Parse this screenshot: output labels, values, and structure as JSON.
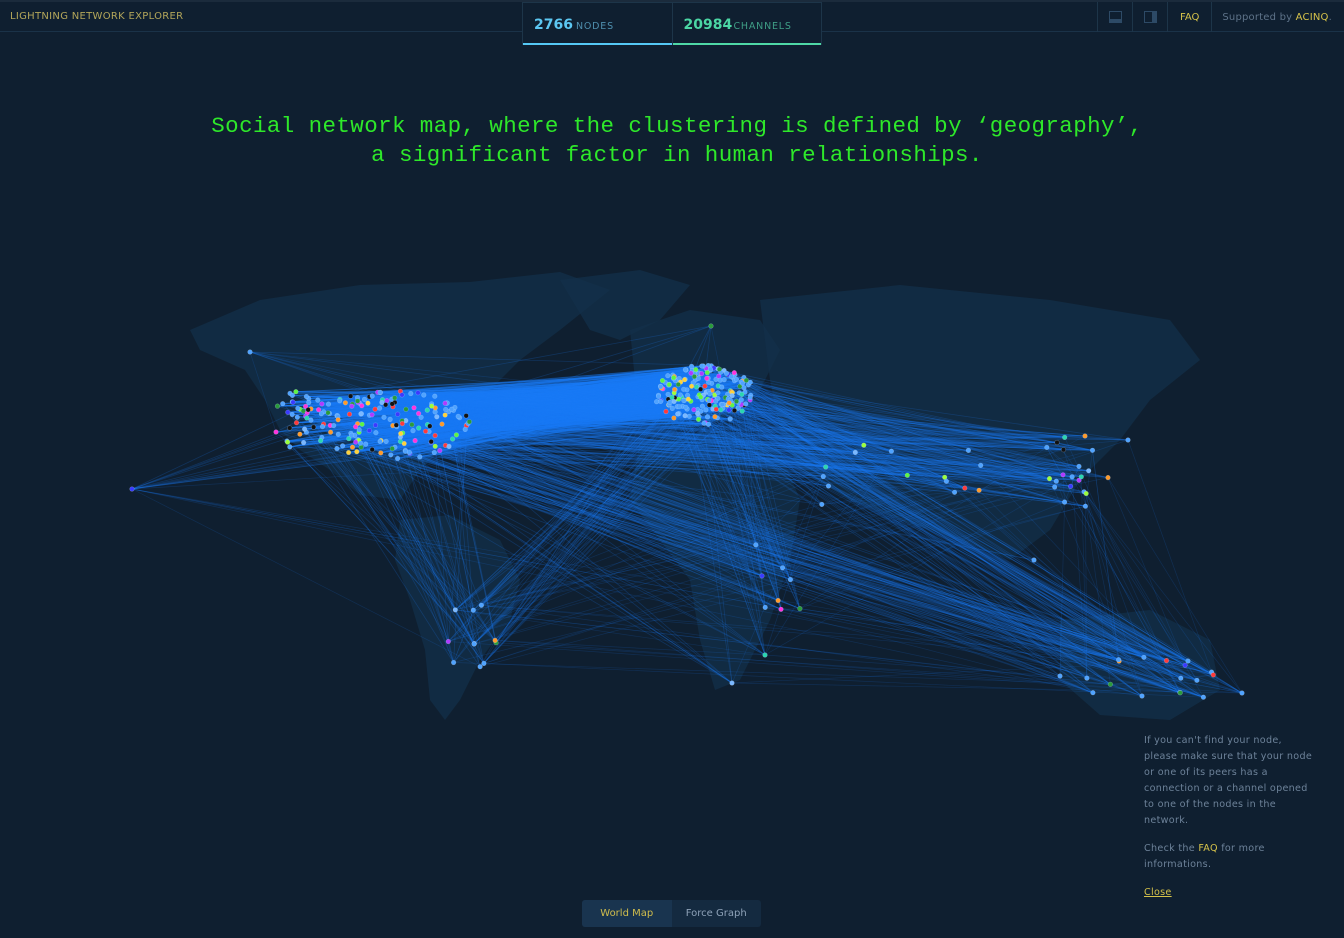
{
  "app": {
    "title": "LIGHTNING NETWORK EXPLORER"
  },
  "stats": {
    "nodes": {
      "value": "2766",
      "label": "NODES",
      "color": "#55c8f5"
    },
    "channels": {
      "value": "20984",
      "label": "CHANNELS",
      "color": "#4fd8a6"
    }
  },
  "nav": {
    "icons": [
      "bottom-panel-icon",
      "side-panel-icon"
    ],
    "faq": "FAQ",
    "supported_prefix": "Supported by ",
    "supported_brand": "ACINQ",
    "supported_suffix": "."
  },
  "headline": {
    "line1": "Social network map, where the clustering is defined by ‘geography’,",
    "line2": "a significant factor in human relationships.",
    "color": "#2ee82a"
  },
  "info_panel": {
    "message": "If you can't find your node, please make sure that your node or one of its peers has a connection or a channel opened to one of the nodes in the network.",
    "check_prefix": "Check the ",
    "check_link": "FAQ",
    "check_suffix": " for more informations.",
    "close": "Close"
  },
  "view_toggle": {
    "options": [
      "World Map",
      "Force Graph"
    ],
    "selected": "World Map"
  },
  "map": {
    "edge_color": "#1a7cf5",
    "land_color": "#13304a",
    "node_colors": [
      "#4fa3ff",
      "#5ef542",
      "#9bff3a",
      "#ff3a3a",
      "#ff33dd",
      "#3a3aff",
      "#ffd23a",
      "#ff9a2a",
      "#2ad6b0",
      "#7ab8ff",
      "#2a9a3a",
      "#b03aff",
      "#111111"
    ]
  }
}
